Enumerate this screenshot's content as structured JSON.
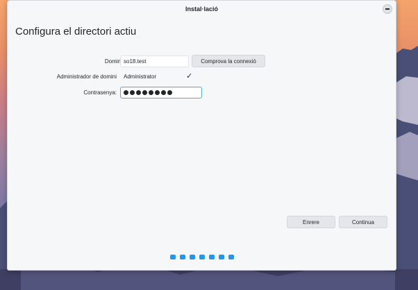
{
  "window": {
    "title": "Instal·lació"
  },
  "page": {
    "heading": "Configura el directori actiu"
  },
  "form": {
    "domain_label": "Domini:",
    "domain_value": "so18.test",
    "check_button": "Comprova la connexió",
    "admin_label": "Administrador de domini",
    "admin_value": "Administrator",
    "password_label": "Contrasenya:",
    "password_dots": 8
  },
  "footer": {
    "back_label": "Enrere",
    "next_label": "Continua"
  },
  "steps": {
    "total": 7
  },
  "colors": {
    "accent": "#1d99f3",
    "focus": "#3daee9",
    "window_bg": "#f6f7f9"
  }
}
